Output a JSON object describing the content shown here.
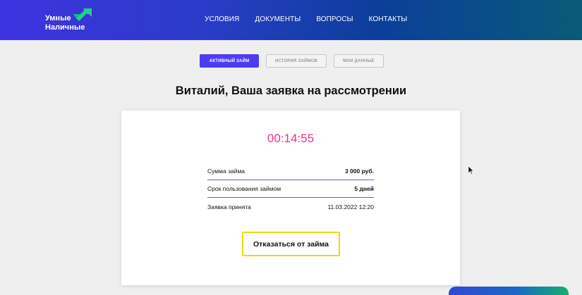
{
  "header": {
    "logo": {
      "line1": "Умные",
      "line2": "Наличные"
    },
    "nav": [
      "УСЛОВИЯ",
      "ДОКУМЕНТЫ",
      "ВОПРОСЫ",
      "КОНТАКТЫ"
    ],
    "colors": {
      "gradient_start": "#3f33e0",
      "gradient_end": "#0a5a78"
    }
  },
  "tabs": {
    "active": "АКТИВНЫЙ ЗАЙМ",
    "history": "ИСТОРИЯ ЗАЙМОВ",
    "my_data": "МОИ ДАННЫЕ"
  },
  "main": {
    "title": "Виталий, Ваша заявка на рассмотрении",
    "timer": "00:14:55",
    "rows": [
      {
        "label": "Сумма займа",
        "value": "3 000 руб."
      },
      {
        "label": "Срок пользования займом",
        "value": "5 дней"
      },
      {
        "label": "Заявка принята",
        "value": "11.03.2022 12:20"
      }
    ],
    "cancel_label": "Отказаться от займа"
  },
  "colors": {
    "accent": "#4d3df2",
    "timer": "#ee2f8e",
    "button_border": "#f2d60d"
  }
}
